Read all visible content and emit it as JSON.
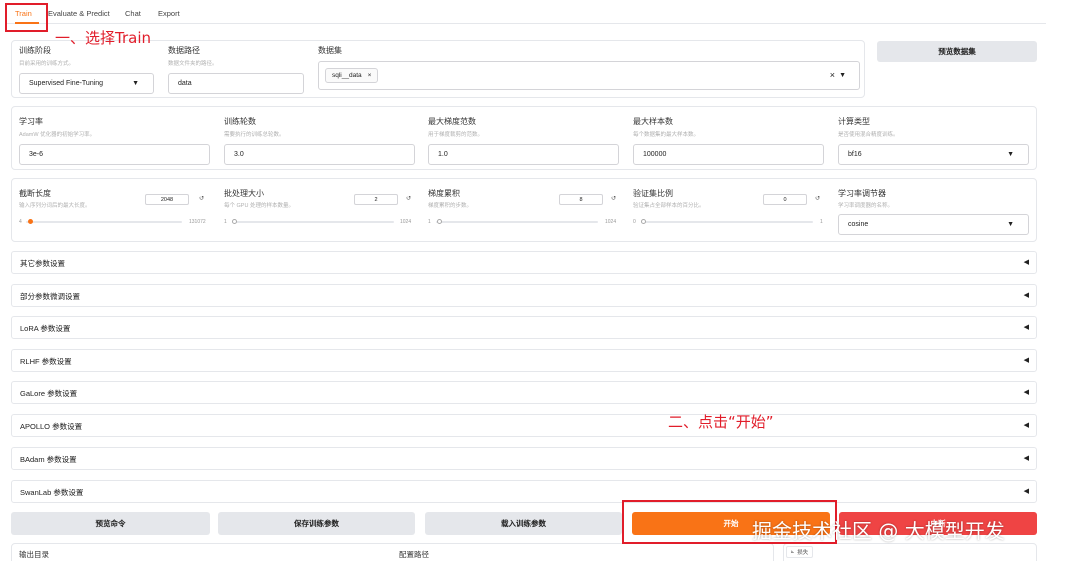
{
  "tabs": [
    "Train",
    "Evaluate & Predict",
    "Chat",
    "Export"
  ],
  "row1": {
    "stage": {
      "label": "训练阶段",
      "desc": "目前采用的训练方式。",
      "value": "Supervised Fine-Tuning"
    },
    "data_dir": {
      "label": "数据路径",
      "desc": "数据文件夹的路径。",
      "value": "data"
    },
    "dataset": {
      "label": "数据集",
      "value": "sqli__data",
      "chip_close": "×",
      "clear": "×"
    },
    "preview_button": "预览数据集"
  },
  "row2": [
    {
      "label": "学习率",
      "desc": "AdamW 优化器的初始学习率。",
      "value": "3e-6"
    },
    {
      "label": "训练轮数",
      "desc": "需要执行的训练总轮数。",
      "value": "3.0"
    },
    {
      "label": "最大梯度范数",
      "desc": "用于梯度裁剪的范数。",
      "value": "1.0"
    },
    {
      "label": "最大样本数",
      "desc": "每个数据集的最大样本数。",
      "value": "100000"
    },
    {
      "label": "计算类型",
      "desc": "是否使用混合精度训练。",
      "value": "bf16"
    }
  ],
  "row3": [
    {
      "label": "截断长度",
      "desc": "输入序列分词后的最大长度。",
      "value": "2048",
      "min": "4",
      "max": "131072",
      "fraction": 0.016
    },
    {
      "label": "批处理大小",
      "desc": "每个 GPU 处理的样本数量。",
      "value": "2",
      "min": "1",
      "max": "1024",
      "fraction": 0.001
    },
    {
      "label": "梯度累积",
      "desc": "梯度累积的步数。",
      "value": "8",
      "min": "1",
      "max": "1024",
      "fraction": 0.007
    },
    {
      "label": "验证集比例",
      "desc": "验证集占全部样本的百分比。",
      "value": "0",
      "min": "0",
      "max": "1",
      "fraction": 0.0
    }
  ],
  "scheduler": {
    "label": "学习率调节器",
    "desc": "学习率调度器的名称。",
    "value": "cosine"
  },
  "reset_icon": "reset-icon",
  "accordions": [
    "其它参数设置",
    "部分参数微调设置",
    "LoRA 参数设置",
    "RLHF 参数设置",
    "GaLore 参数设置",
    "APOLLO 参数设置",
    "BAdam 参数设置",
    "SwanLab 参数设置"
  ],
  "buttons": {
    "preview_cmd": "预览命令",
    "save_args": "保存训练参数",
    "load_args": "载入训练参数",
    "start": "开始",
    "stop": "中断"
  },
  "bottom": {
    "output_dir": "输出目录",
    "config_path": "配置路径",
    "loss_tag": "损失"
  },
  "annotations": {
    "step1": "一、选择Train",
    "step2": "二、点击“开始”"
  },
  "watermark": "掘金技术社区 @ 大模型开发",
  "colors": {
    "accent": "#f97316",
    "stop": "#ef4444",
    "annotation": "#e11d2a",
    "button_gray": "#e5e7eb"
  }
}
